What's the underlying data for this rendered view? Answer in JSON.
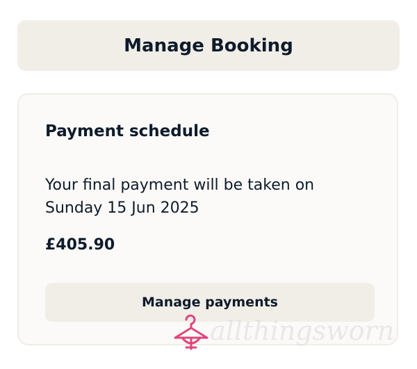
{
  "header": {
    "manage_booking_label": "Manage Booking"
  },
  "payment_card": {
    "title": "Payment schedule",
    "description_line1": "Your final payment will be taken on",
    "description_line2": "Sunday 15 Jun 2025",
    "amount": "£405.90",
    "manage_payments_label": "Manage payments"
  },
  "watermark": {
    "text": "allthingsworn",
    "icon": "hanger-bow-icon",
    "color": "#e0457b"
  },
  "colors": {
    "button_bg": "#f1eee8",
    "card_bg": "#fbfaf8",
    "card_border": "#f0ede7",
    "text": "#0e1b2b"
  }
}
